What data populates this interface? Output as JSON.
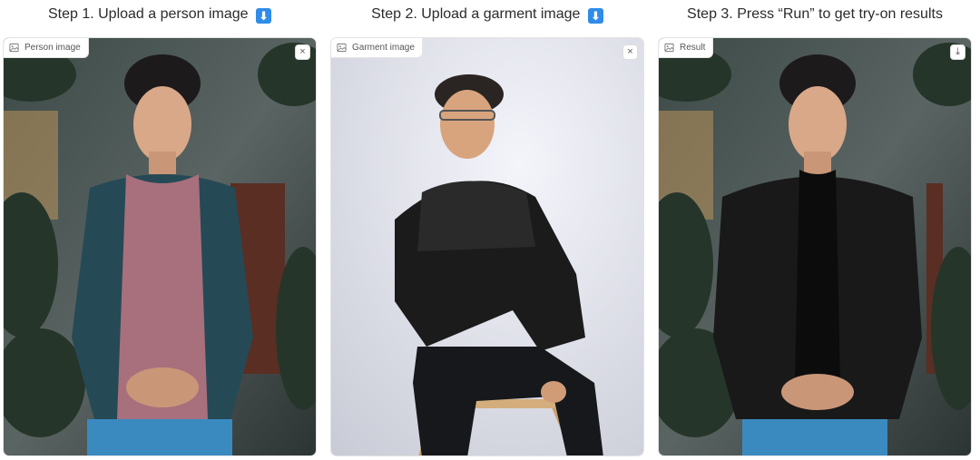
{
  "steps": [
    {
      "title": "Step 1. Upload a person image",
      "arrow_icon": "down-arrow-icon",
      "panel_label": "Person image",
      "corner_action": "clear",
      "corner_glyph": "×"
    },
    {
      "title": "Step 2. Upload a garment image",
      "arrow_icon": "down-arrow-icon",
      "panel_label": "Garment image",
      "corner_action": "clear",
      "corner_glyph": "×"
    },
    {
      "title": "Step 3. Press “Run” to get try-on results",
      "panel_label": "Result",
      "corner_action": "download",
      "corner_glyph": "⤓"
    }
  ],
  "arrow_glyph": "⬇",
  "colors": {
    "arrow_badge": "#2f8ce8",
    "title_text": "#2b2b2b",
    "chip_text": "#555555"
  }
}
